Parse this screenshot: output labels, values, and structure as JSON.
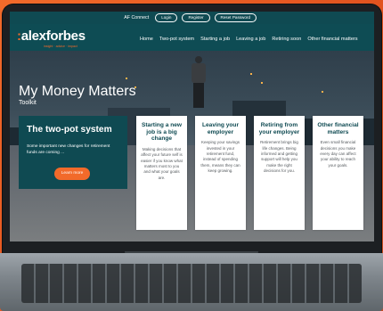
{
  "topbar": {
    "af_connect": "AF Connect",
    "login": "Login",
    "register": "Register",
    "reset_password": "Reset Password"
  },
  "header": {
    "logo_colon": ":",
    "logo_text": "alexforbes",
    "tagline": "insight · advice · impact",
    "nav": [
      "Home",
      "Two-pot system",
      "Starting a job",
      "Leaving a job",
      "Retiring soon",
      "Other financial matters"
    ]
  },
  "hero": {
    "title": "My Money Matters",
    "subtitle": "Toolkit"
  },
  "featured": {
    "title": "The two-pot system",
    "text": "Some important new changes for retirement funds are coming ...",
    "button": "Learn more"
  },
  "cards": [
    {
      "title": "Starting a new job is a big change",
      "text": "Making decisions that affect your future self is easier if you know what matters most to you and what your goals are."
    },
    {
      "title": "Leaving your employer",
      "text": "Keeping your savings invested in your retirement fund, instead of spending them, means they can keep growing."
    },
    {
      "title": "Retiring from your employer",
      "text": "Retirement brings big life changes. Being informed and getting support will help you make the right decisions for you."
    },
    {
      "title": "Other financial matters",
      "text": "Even small financial decisions you make every day can affect your ability to reach your goals."
    }
  ],
  "colors": {
    "accent": "#f26a2a",
    "brand": "#0f4a52"
  }
}
